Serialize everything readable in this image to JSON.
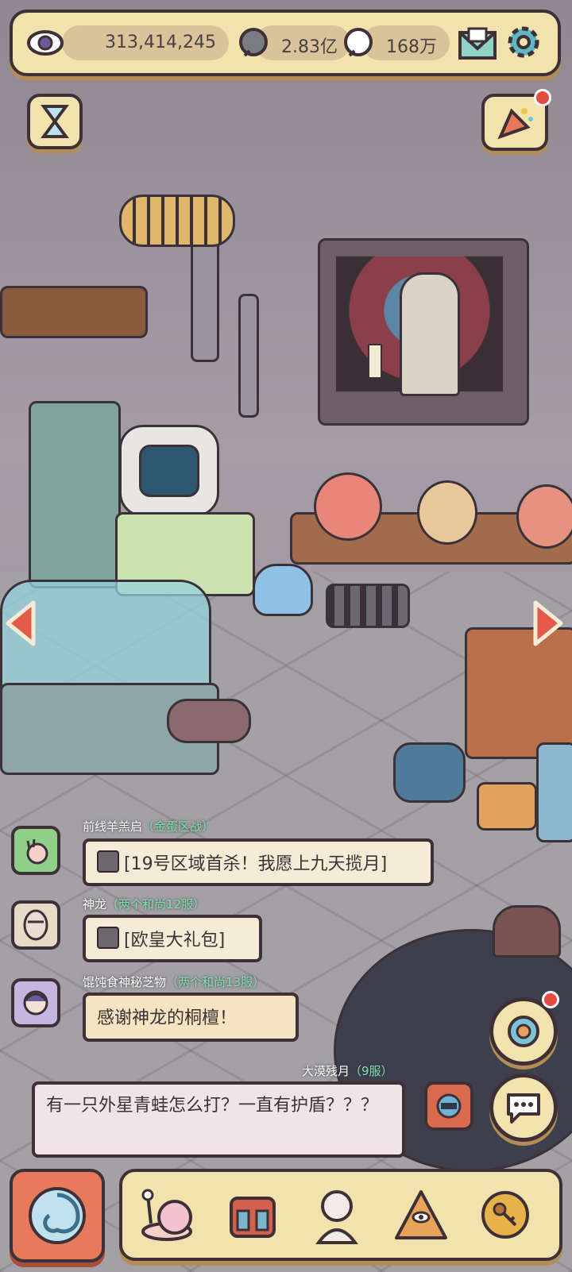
{
  "resources": {
    "eyes": "313,414,245",
    "stones": "2.83亿",
    "bubbles": "168万"
  },
  "top_icons": {
    "mail": "mail-icon",
    "settings": "gear-icon",
    "timer": "hourglass-icon",
    "event": "party-popper-icon"
  },
  "chat": [
    {
      "name": "前线羊羔启",
      "server": "（金蛋区战）",
      "message": "[19号区域首杀！我愿上九天揽月]",
      "gift": true
    },
    {
      "name": "神龙",
      "server": "（两个和尚12服）",
      "message": "[欧皇大礼包]",
      "gift": true
    },
    {
      "name": "馄饨食神秘芝物",
      "server": "（两个和尚13服）",
      "message": "感谢神龙的桐檀！",
      "gift": false
    },
    {
      "name": "大漠残月",
      "server": "（9服）",
      "message": "有一只外星青蛙怎么打？一直有护盾？？？",
      "gift": false
    }
  ],
  "bottom_nav": [
    "snail-icon",
    "backpack-icon",
    "statue-icon",
    "pyramid-eye-icon",
    "key-coin-icon"
  ],
  "colors": {
    "panel": "#f2e2ae",
    "outline": "#3e3036",
    "accent_red": "#e34c3f",
    "server_green": "#7ee0b4"
  }
}
